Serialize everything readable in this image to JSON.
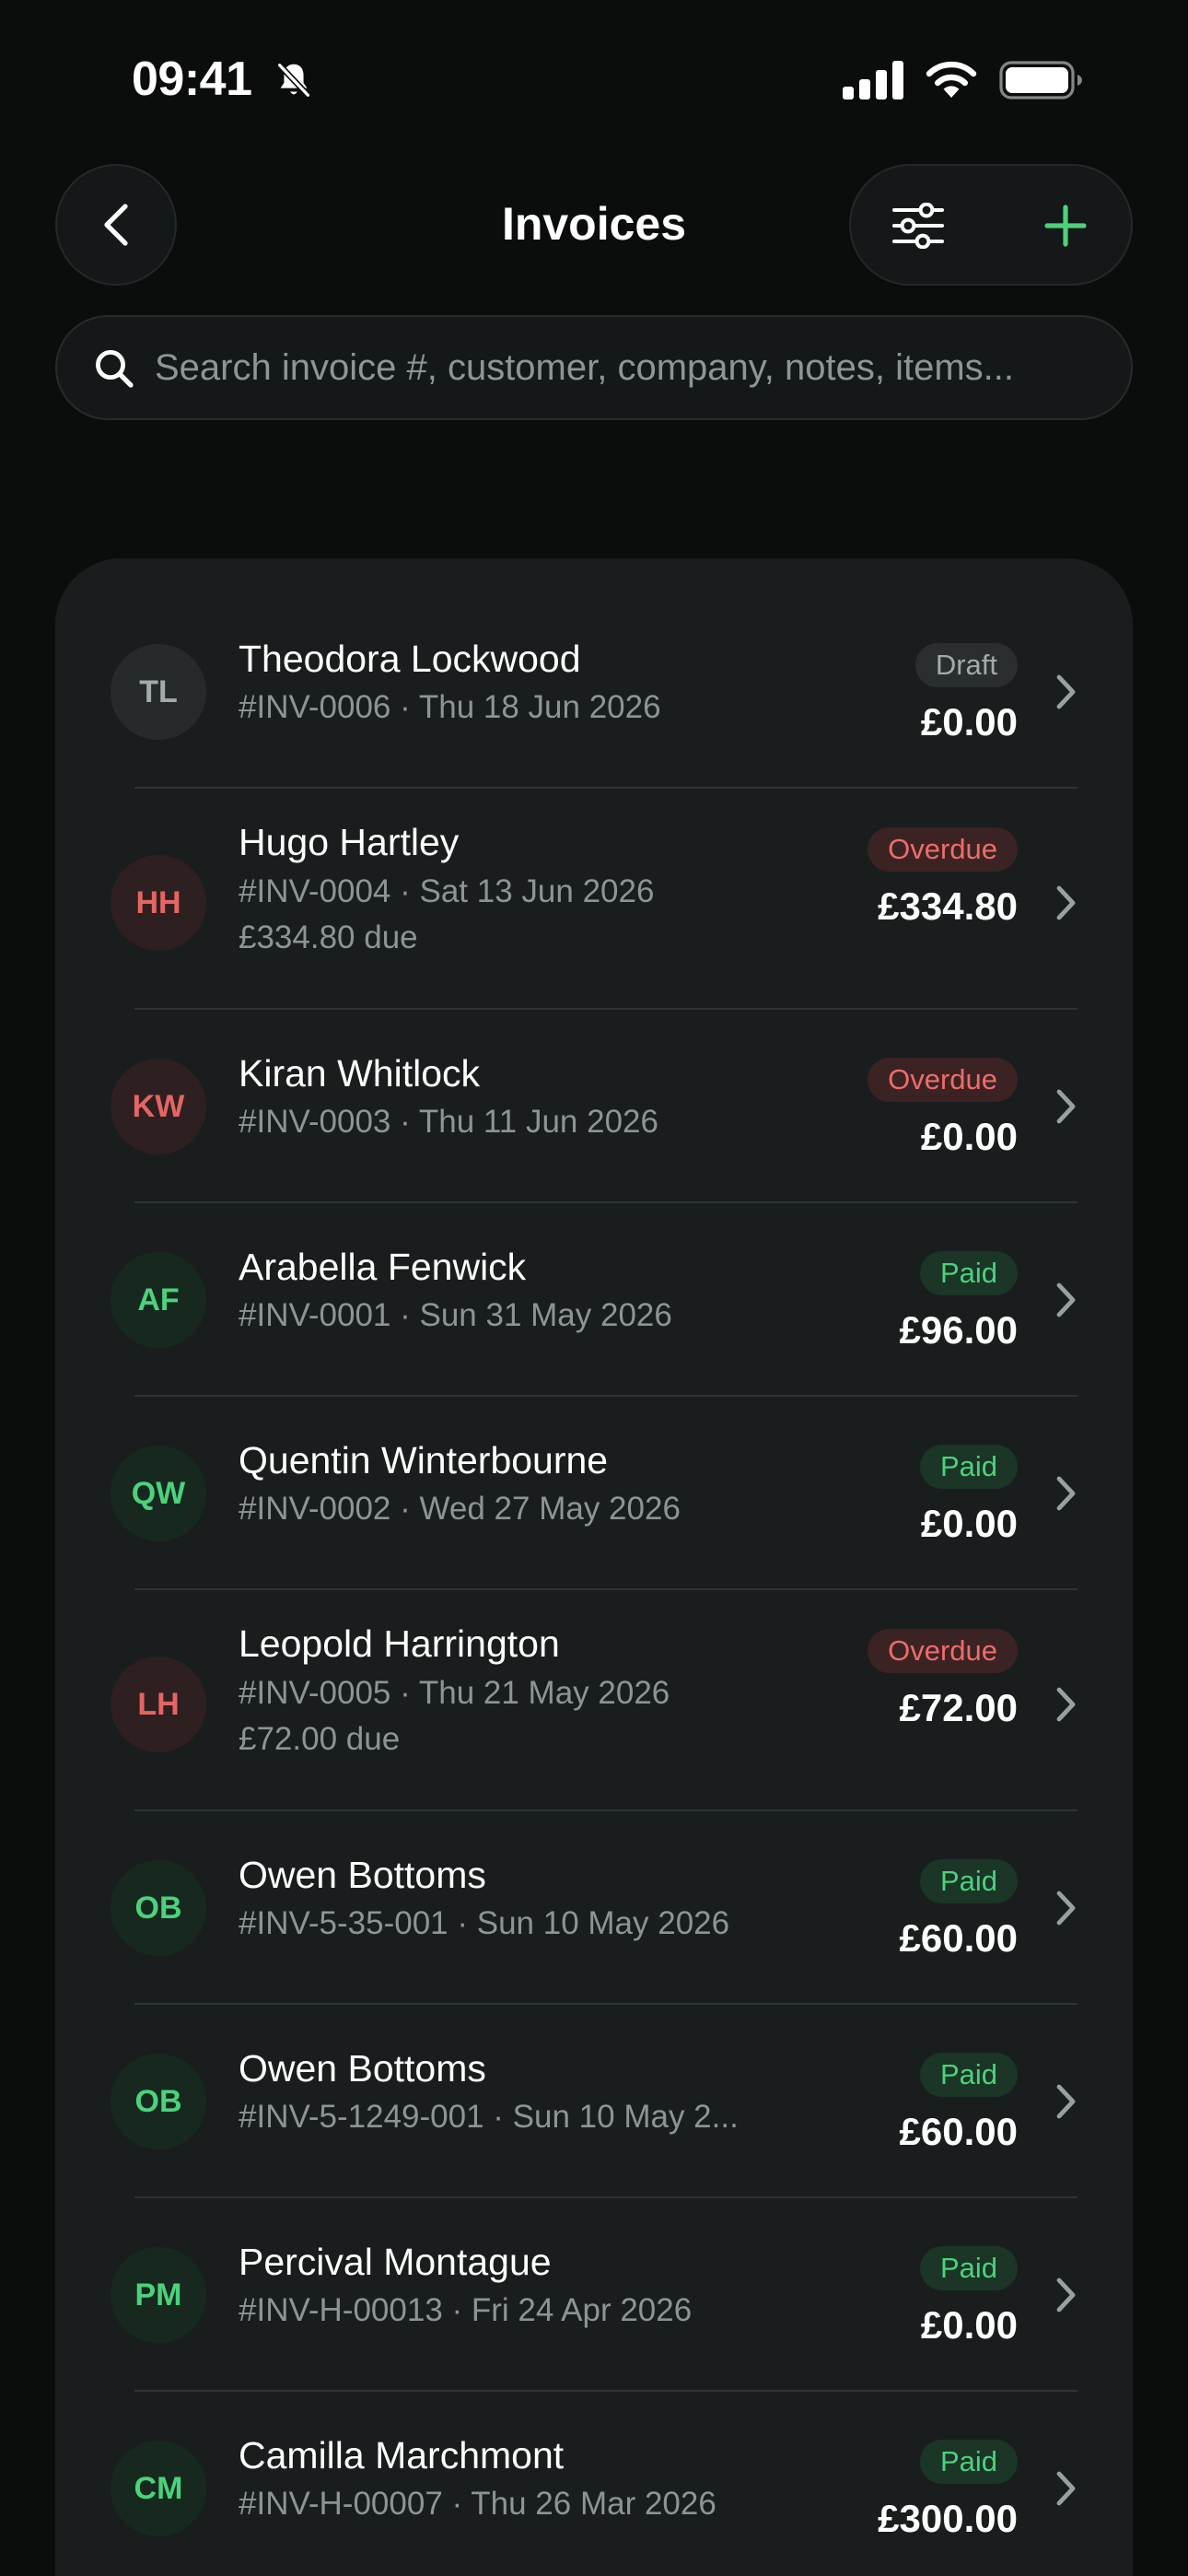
{
  "status_bar": {
    "time": "09:41",
    "icons": [
      "bell-slash-icon",
      "cellular-signal-icon",
      "wifi-icon",
      "battery-icon"
    ]
  },
  "header": {
    "title": "Invoices",
    "back_icon": "chevron-left-icon",
    "filter_icon": "sliders-icon",
    "add_icon": "plus-icon"
  },
  "search": {
    "placeholder": "Search invoice #, customer, company, notes, items...",
    "value": ""
  },
  "colors": {
    "background": "#0b0d0d",
    "card": "#1a1d1d",
    "accent": "#4bd27c",
    "overdue": "#f06b6b",
    "draft": "#a4aaaa"
  },
  "invoices": [
    {
      "initials": "TL",
      "name": "Theodora Lockwood",
      "meta": "#INV-0006 · Thu 18 Jun 2026",
      "due": "",
      "status": "Draft",
      "amount": "£0.00"
    },
    {
      "initials": "HH",
      "name": "Hugo Hartley",
      "meta": "#INV-0004 · Sat 13 Jun 2026",
      "due": "£334.80 due",
      "status": "Overdue",
      "amount": "£334.80"
    },
    {
      "initials": "KW",
      "name": "Kiran Whitlock",
      "meta": "#INV-0003 · Thu 11 Jun 2026",
      "due": "",
      "status": "Overdue",
      "amount": "£0.00"
    },
    {
      "initials": "AF",
      "name": "Arabella Fenwick",
      "meta": "#INV-0001 · Sun 31 May 2026",
      "due": "",
      "status": "Paid",
      "amount": "£96.00"
    },
    {
      "initials": "QW",
      "name": "Quentin Winterbourne",
      "meta": "#INV-0002 · Wed 27 May 2026",
      "due": "",
      "status": "Paid",
      "amount": "£0.00"
    },
    {
      "initials": "LH",
      "name": "Leopold Harrington",
      "meta": "#INV-0005 · Thu 21 May 2026",
      "due": "£72.00 due",
      "status": "Overdue",
      "amount": "£72.00"
    },
    {
      "initials": "OB",
      "name": "Owen Bottoms",
      "meta": "#INV-5-35-001 · Sun 10 May 2026",
      "due": "",
      "status": "Paid",
      "amount": "£60.00"
    },
    {
      "initials": "OB",
      "name": "Owen Bottoms",
      "meta": "#INV-5-1249-001 · Sun 10 May 2...",
      "due": "",
      "status": "Paid",
      "amount": "£60.00"
    },
    {
      "initials": "PM",
      "name": "Percival Montague",
      "meta": "#INV-H-00013 · Fri 24 Apr 2026",
      "due": "",
      "status": "Paid",
      "amount": "£0.00"
    },
    {
      "initials": "CM",
      "name": "Camilla Marchmont",
      "meta": "#INV-H-00007 · Thu 26 Mar 2026",
      "due": "",
      "status": "Paid",
      "amount": "£300.00"
    }
  ]
}
